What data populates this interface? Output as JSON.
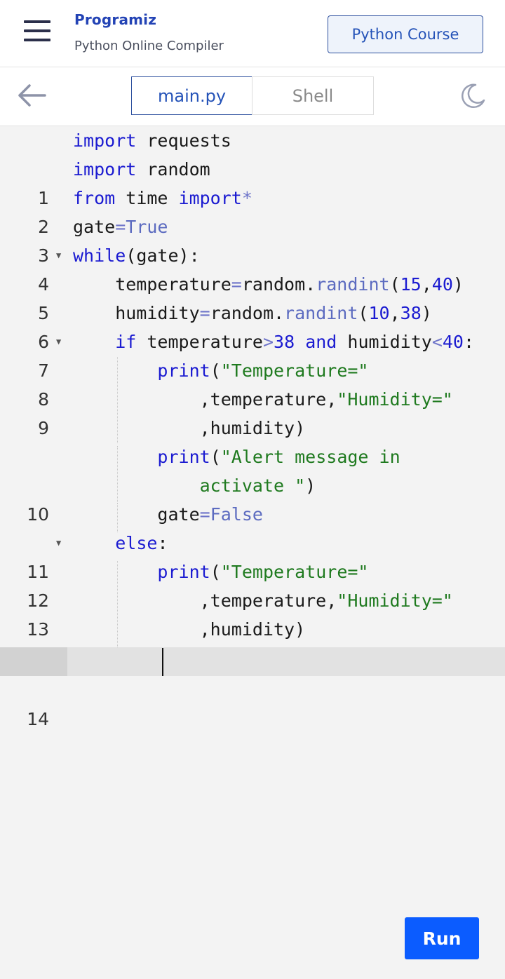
{
  "header": {
    "brand_name": "Programiz",
    "brand_subtitle": "Python Online Compiler",
    "course_button_label": "Python Course"
  },
  "toolbar": {
    "tabs": [
      {
        "label": "main.py",
        "active": true
      },
      {
        "label": "Shell",
        "active": false
      }
    ],
    "back_icon": "arrow-left-icon",
    "theme_icon": "moon-icon"
  },
  "editor": {
    "language": "python",
    "cursor_line": 14,
    "lines": [
      {
        "num": "1",
        "text": "import requests"
      },
      {
        "num": "2",
        "text": "import random"
      },
      {
        "num": "3",
        "text": "from time import*"
      },
      {
        "num": "4",
        "text": "gate=True"
      },
      {
        "num": "5",
        "text": "while(gate):",
        "foldable": true
      },
      {
        "num": "6",
        "text": "    temperature=random.randint(15,40)"
      },
      {
        "num": "7",
        "text": "    humidity=random.randint(10,38)"
      },
      {
        "num": "8",
        "text": "    if temperature>38 and humidity<40:",
        "foldable": true
      },
      {
        "num": "9",
        "text": "        print(\"Temperature=\" ,temperature,\"Humidity=\" ,humidity)"
      },
      {
        "num": "10",
        "text": "        print(\"Alert message in activate \")"
      },
      {
        "num": "11",
        "text": "        gate=False"
      },
      {
        "num": "12",
        "text": "    else:",
        "foldable": true
      },
      {
        "num": "13",
        "text": "        print(\"Temperature=\" ,temperature,\"Humidity=\" ,humidity)"
      },
      {
        "num": "14",
        "text": ""
      }
    ]
  },
  "run_button_label": "Run",
  "colors": {
    "keyword": "#1b1bd1",
    "string": "#1f7a1f",
    "constant": "#5c6bc0",
    "accent": "#0b5cff",
    "brand": "#2343b5"
  }
}
